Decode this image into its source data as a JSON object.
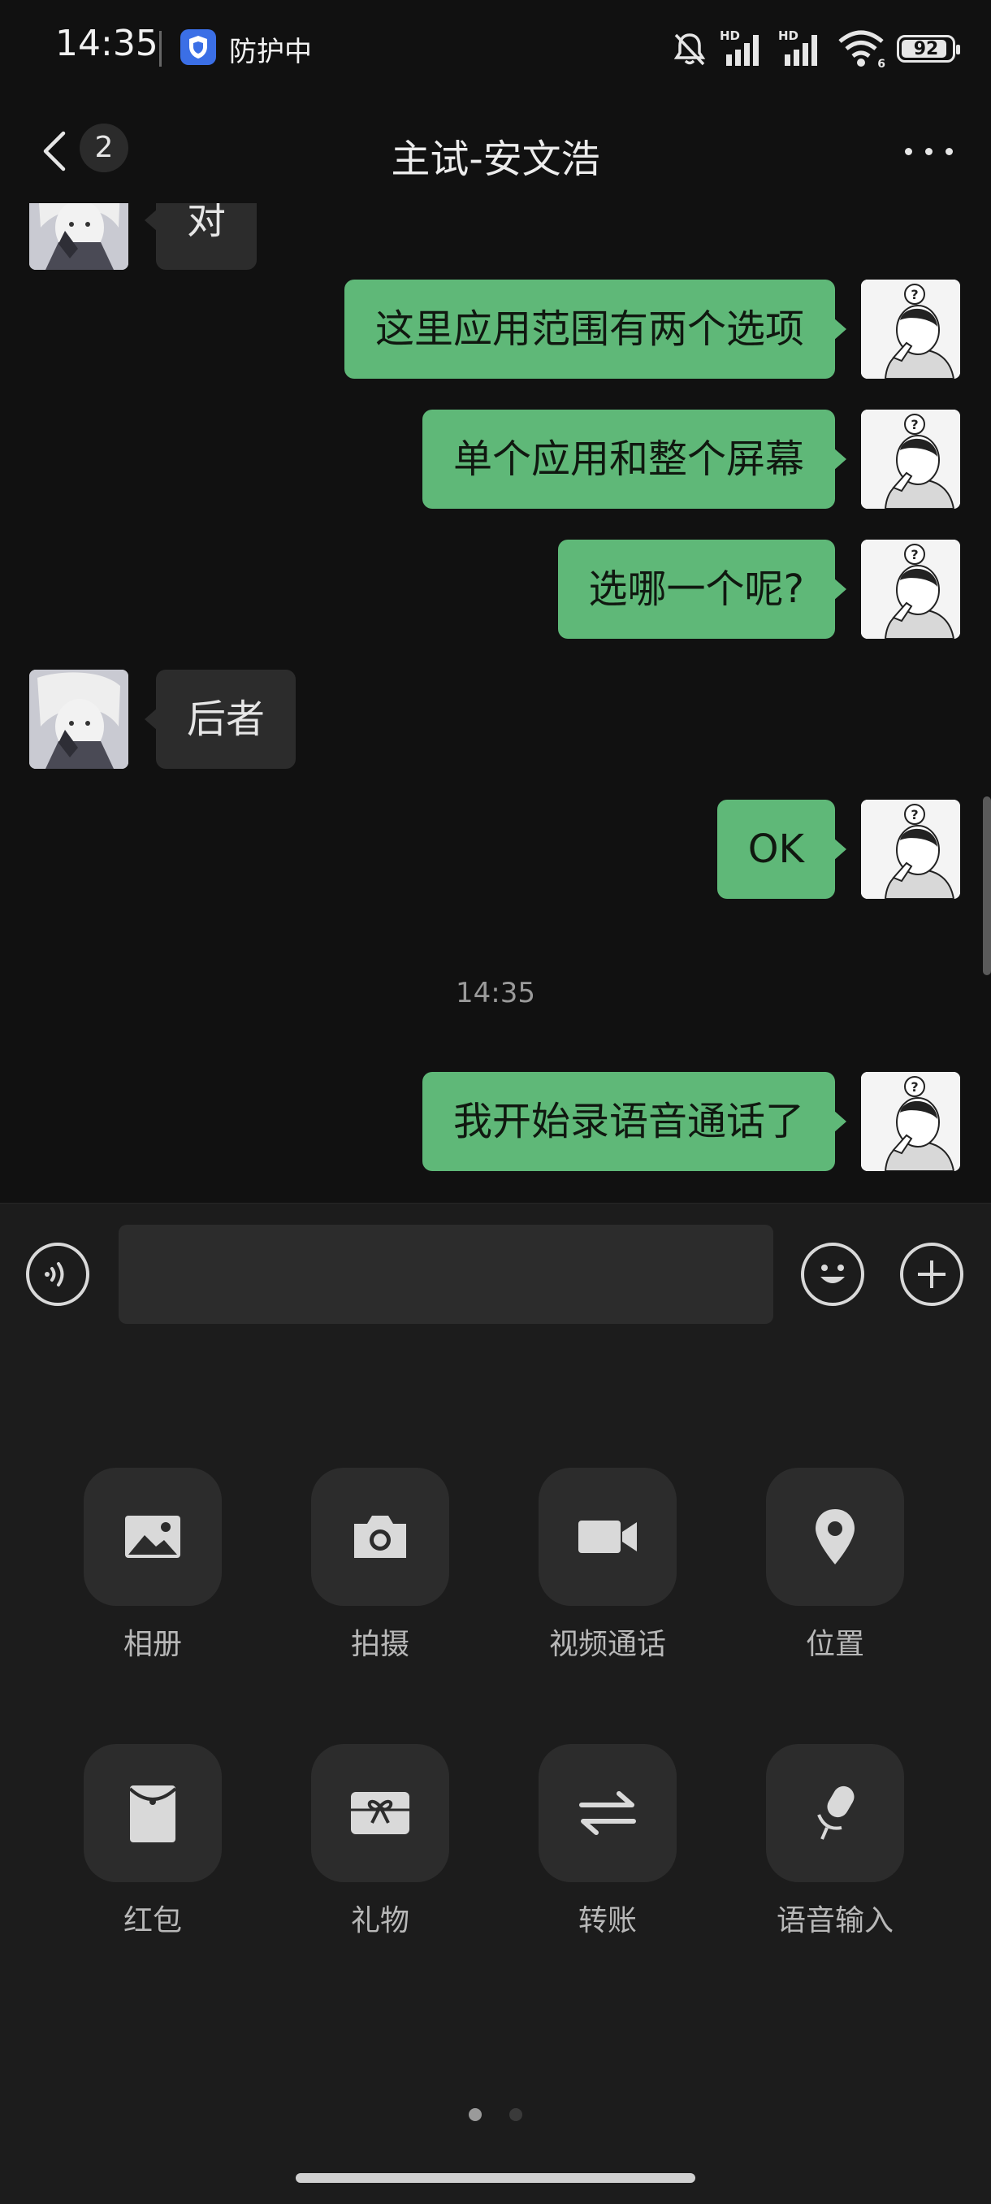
{
  "status_bar": {
    "time": "14:35",
    "protection_text": "防护中",
    "battery": "92",
    "battery_level": 0.92,
    "signal_tags": [
      "HD",
      "HD"
    ],
    "wifi_badge": "6",
    "icons": [
      "shield-icon",
      "bell-muted-icon",
      "signal-icon",
      "wifi-icon",
      "battery-icon"
    ]
  },
  "header": {
    "unread_count": "2",
    "title": "主试-安文浩",
    "icons": [
      "back-icon",
      "more-icon"
    ]
  },
  "messages": [
    {
      "from": "other",
      "text": "对",
      "partial": true
    },
    {
      "from": "me",
      "text": "这里应用范围有两个选项"
    },
    {
      "from": "me",
      "text": "单个应用和整个屏幕"
    },
    {
      "from": "me",
      "text": "选哪一个呢?"
    },
    {
      "from": "other",
      "text": "后者"
    },
    {
      "from": "me",
      "text": "OK"
    },
    {
      "type": "timestamp",
      "text": "14:35"
    },
    {
      "from": "me",
      "text": "我开始录语音通话了"
    }
  ],
  "input_bar": {
    "value": "",
    "icons": [
      "voice-icon",
      "emoji-icon",
      "plus-icon"
    ]
  },
  "tools": [
    {
      "label": "相册",
      "icon": "image-icon"
    },
    {
      "label": "拍摄",
      "icon": "camera-icon"
    },
    {
      "label": "视频通话",
      "icon": "video-call-icon"
    },
    {
      "label": "位置",
      "icon": "location-icon"
    },
    {
      "label": "红包",
      "icon": "red-packet-icon"
    },
    {
      "label": "礼物",
      "icon": "gift-icon"
    },
    {
      "label": "转账",
      "icon": "transfer-icon"
    },
    {
      "label": "语音输入",
      "icon": "microphone-icon"
    }
  ],
  "pager": {
    "pages": 2,
    "active": 1
  },
  "colors": {
    "background": "#111111",
    "panel": "#1c1c1c",
    "my_bubble": "#5fb878",
    "other_bubble": "#2c2c2c"
  }
}
